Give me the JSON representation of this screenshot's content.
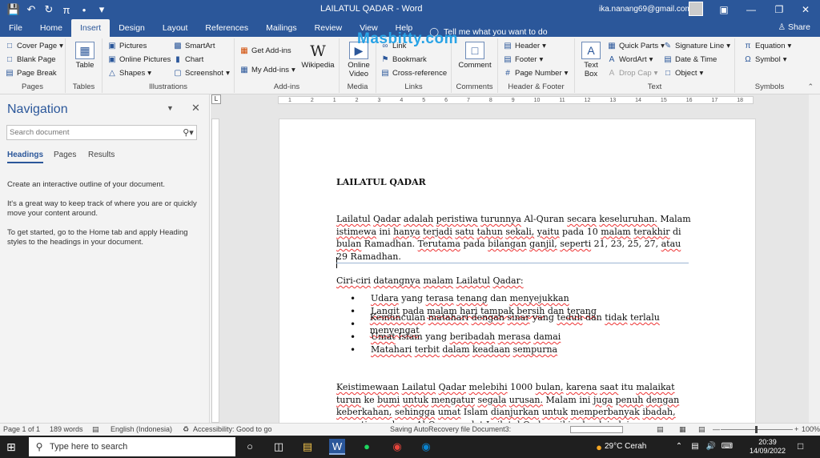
{
  "titlebar": {
    "doc_title": "LAILATUL QADAR - Word",
    "user_email": "ika.nanang69@gmail.com",
    "qat_icons": [
      "save-icon",
      "undo-icon",
      "redo-icon",
      "pi-icon",
      "bullet-icon",
      "customize-icon"
    ]
  },
  "tabs": [
    "File",
    "Home",
    "Insert",
    "Design",
    "Layout",
    "References",
    "Mailings",
    "Review",
    "View",
    "Help"
  ],
  "active_tab": "Insert",
  "tellme": "Tell me what you want to do",
  "share": "Share",
  "watermark": "Masbitty.com",
  "ribbon": {
    "pages": {
      "items": [
        "Cover Page",
        "Blank Page",
        "Page Break"
      ],
      "label": "Pages"
    },
    "tables": {
      "table": "Table",
      "label": "Tables"
    },
    "illustrations": {
      "items": [
        "Pictures",
        "Online Pictures",
        "Shapes",
        "SmartArt",
        "Chart",
        "Screenshot"
      ],
      "label": "Illustrations"
    },
    "addins": {
      "get": "Get Add-ins",
      "my": "My Add-ins",
      "wiki": "Wikipedia",
      "label": "Add-ins"
    },
    "media": {
      "online_video": "Online Video",
      "label": "Media"
    },
    "links": {
      "items": [
        "Link",
        "Bookmark",
        "Cross-reference"
      ],
      "label": "Links"
    },
    "comments": {
      "comment": "Comment",
      "label": "Comments"
    },
    "header_footer": {
      "items": [
        "Header",
        "Footer",
        "Page Number"
      ],
      "label": "Header & Footer"
    },
    "text": {
      "textbox": "Text Box",
      "items": [
        "Quick Parts",
        "WordArt",
        "Drop Cap",
        "Signature Line",
        "Date & Time",
        "Object"
      ],
      "label": "Text"
    },
    "symbols": {
      "items": [
        "Equation",
        "Symbol"
      ],
      "label": "Symbols"
    }
  },
  "navigation": {
    "title": "Navigation",
    "search_placeholder": "Search document",
    "tabs": [
      "Headings",
      "Pages",
      "Results"
    ],
    "active_tab": "Headings",
    "paragraphs": [
      "Create an interactive outline of your document.",
      "It's a great way to keep track of where you are or quickly move your content around.",
      "To get started, go to the Home tab and apply Heading styles to the headings in your document."
    ]
  },
  "ruler_marks": [
    "1",
    "2",
    "1",
    "2",
    "3",
    "4",
    "5",
    "6",
    "7",
    "8",
    "9",
    "10",
    "11",
    "12",
    "13",
    "14",
    "15",
    "16",
    "17",
    "18"
  ],
  "document": {
    "heading": "LAILATUL QADAR",
    "para1": "Lailatul Qadar adalah peristiwa turunnya Al-Quran secara keseluruhan. Malam istimewa ini hanya terjadi satu tahun sekali, yaitu pada 10 malam terakhir di bulan Ramadhan. Terutama pada bilangan ganjil, seperti 21, 23, 25, 27, atau 29 Ramadhan.",
    "list_intro": "Ciri-ciri datangnya malam Lailatul Qadar:",
    "bullets": [
      "Udara yang terasa tenang dan menyejukkan",
      "Langit pada malam hari tampak bersih dan terang",
      "Kemunculan matahari dengan sinar yang teduh dan tidak terlalu menyengat",
      "Umat Islam yang beribadah merasa damai",
      "Matahari terbit dalam keadaan sempurna"
    ],
    "para2": "Keistimewaan Lailatul Qadar melebihi 1000 bulan, karena saat itu malaikat turun ke bumi untuk mengatur segala urusan. Malam ini juga penuh dengan keberkahan, sehingga umat Islam dianjurkan untuk memperbanyak ibadah, seperti membaca Al-Quran, salat Lailatul Qadar, zikir, dan lain-lain."
  },
  "status": {
    "page": "Page 1 of 1",
    "words": "189 words",
    "language": "English (Indonesia)",
    "accessibility": "Accessibility: Good to go",
    "autosave": "Saving AutoRecovery file Document3:",
    "zoom": "100%"
  },
  "taskbar": {
    "search_placeholder": "Type here to search",
    "weather": "29°C  Cerah",
    "time": "20:39",
    "date": "14/09/2022"
  }
}
